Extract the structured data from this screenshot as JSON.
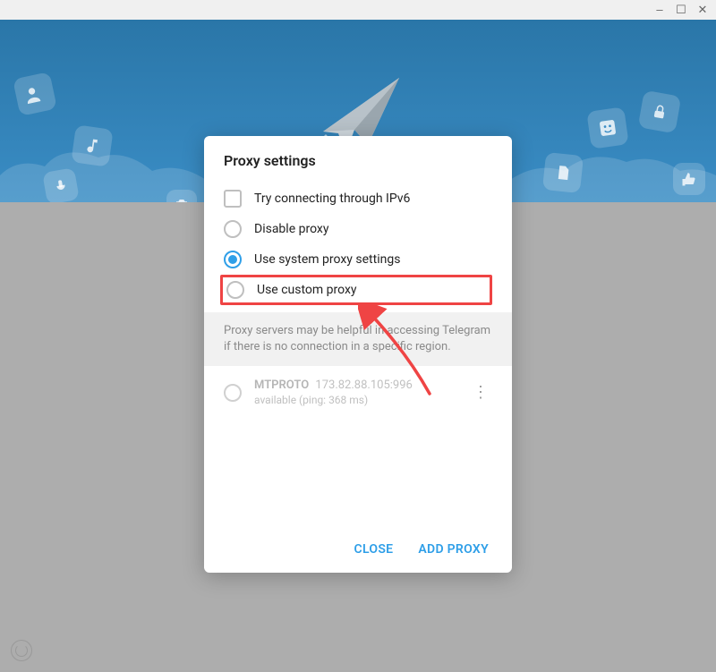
{
  "titlebar": {
    "minimize": "‒",
    "maximize": "☐",
    "close": "✕"
  },
  "modal": {
    "title": "Proxy settings",
    "options": {
      "ipv6": "Try connecting through IPv6",
      "disable": "Disable proxy",
      "system": "Use system proxy settings",
      "custom": "Use custom proxy"
    },
    "selected": "system",
    "info": "Proxy servers may be helpful in accessing Telegram if there is no connection in a specific region.",
    "proxies": [
      {
        "name": "MTPROTO",
        "address": "173.82.88.105:996",
        "status": "available (ping: 368 ms)"
      }
    ],
    "footer": {
      "close": "CLOSE",
      "add": "ADD PROXY"
    }
  }
}
